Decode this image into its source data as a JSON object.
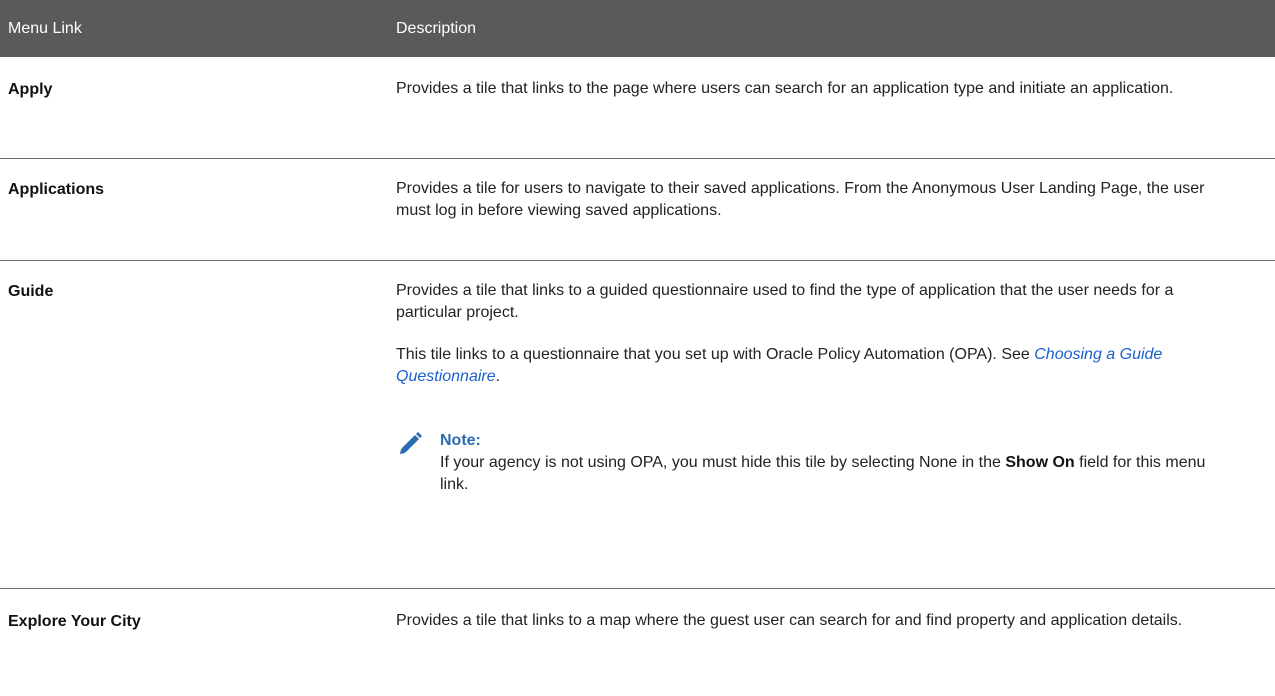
{
  "table": {
    "headers": {
      "menu_link": "Menu Link",
      "description": "Description"
    },
    "rows": [
      {
        "name": "Apply",
        "description": "Provides a tile that links to the page where users can search for an application type and initiate an application."
      },
      {
        "name": "Applications",
        "description": "Provides a tile for users to navigate to their saved applications. From the Anonymous User Landing Page, the user must log in before viewing saved applications."
      },
      {
        "name": "Guide",
        "description": "Provides a tile that links to a guided questionnaire used to find the type of application that the user needs for a particular project.",
        "description_2_prefix": "This tile links to a questionnaire that you set up with Oracle Policy Automation (OPA). See ",
        "description_2_link": "Choosing a Guide Questionnaire",
        "description_2_suffix": ".",
        "note": {
          "title": "Note:",
          "text_before": "If your agency is not using OPA, you must hide this tile by selecting None in the ",
          "text_bold": "Show On",
          "text_after": " field for this menu link.",
          "icon": "pencil-icon",
          "icon_color": "#2b6cb0"
        }
      },
      {
        "name": "Explore Your City",
        "description": "Provides a tile that links to a map where the guest user can search for and find property and application details."
      }
    ]
  },
  "colors": {
    "header_bg": "#5a5a5a",
    "header_text": "#ffffff",
    "link": "#1a5fcc",
    "note_title": "#2b6cb0",
    "divider": "#6b6b6b"
  }
}
